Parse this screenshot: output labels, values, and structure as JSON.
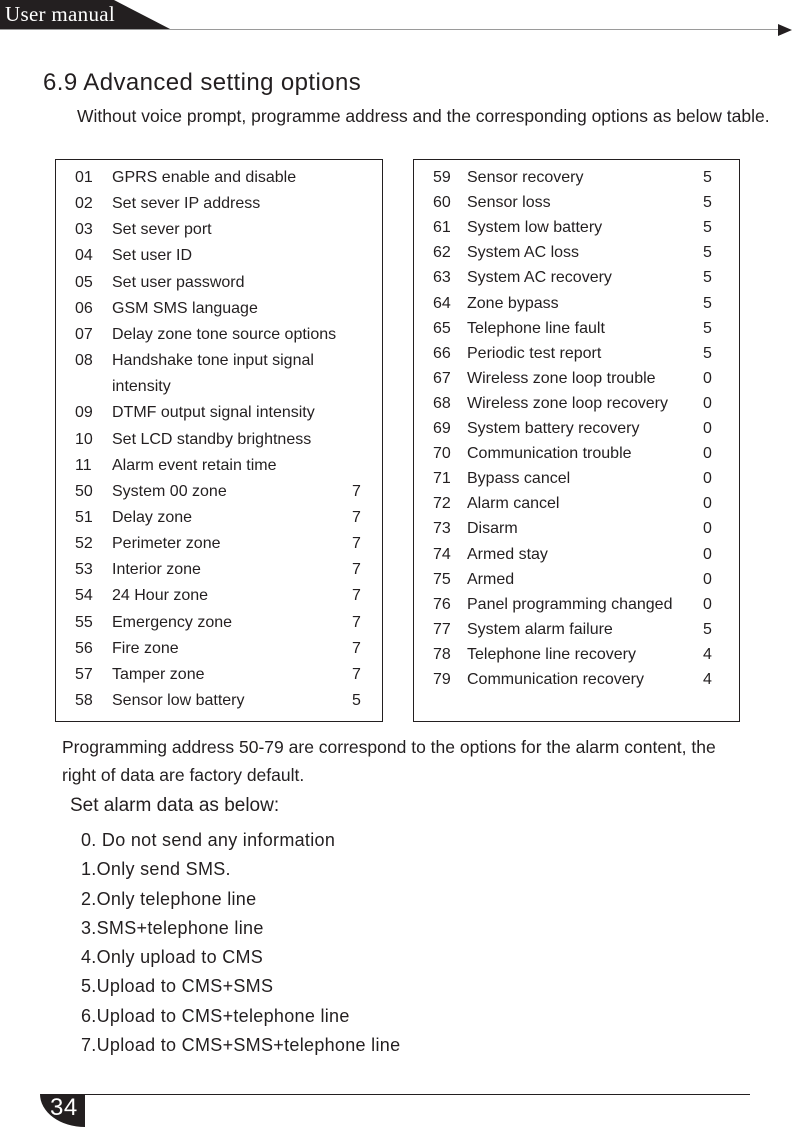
{
  "header": {
    "title": "User manual"
  },
  "section": {
    "title": "6.9 Advanced setting options",
    "intro": "Without voice prompt, programme address and the corresponding options as below table."
  },
  "table_left": [
    {
      "num": "01",
      "label": "GPRS enable and disable",
      "value": ""
    },
    {
      "num": "02",
      "label": "Set sever IP address",
      "value": ""
    },
    {
      "num": "03",
      "label": "Set sever port",
      "value": ""
    },
    {
      "num": "04",
      "label": "Set user ID",
      "value": ""
    },
    {
      "num": "05",
      "label": "Set user password",
      "value": ""
    },
    {
      "num": "06",
      "label": "GSM SMS language",
      "value": ""
    },
    {
      "num": "07",
      "label": "Delay zone tone source options",
      "value": ""
    },
    {
      "num": "08",
      "label": "Handshake tone input signal",
      "value": ""
    },
    {
      "num": "",
      "label": "intensity",
      "value": ""
    },
    {
      "num": "09",
      "label": "DTMF output signal intensity",
      "value": ""
    },
    {
      "num": "10",
      "label": "Set LCD standby brightness",
      "value": ""
    },
    {
      "num": "11",
      "label": "Alarm event retain time",
      "value": ""
    },
    {
      "num": "50",
      "label": "System 00 zone",
      "value": "7"
    },
    {
      "num": "51",
      "label": "Delay zone",
      "value": "7"
    },
    {
      "num": "52",
      "label": "Perimeter zone",
      "value": "7"
    },
    {
      "num": "53",
      "label": "Interior zone",
      "value": "7"
    },
    {
      "num": "54",
      "label": "24 Hour zone",
      "value": "7"
    },
    {
      "num": "55",
      "label": "Emergency zone",
      "value": "7"
    },
    {
      "num": "56",
      "label": "Fire zone",
      "value": "7"
    },
    {
      "num": "57",
      "label": "Tamper zone",
      "value": "7"
    },
    {
      "num": "58",
      "label": "Sensor low battery",
      "value": "5"
    }
  ],
  "table_right": [
    {
      "num": "59",
      "label": "Sensor recovery",
      "value": "5"
    },
    {
      "num": "60",
      "label": "Sensor loss",
      "value": "5"
    },
    {
      "num": "61",
      "label": "System low battery",
      "value": "5"
    },
    {
      "num": "62",
      "label": "System AC loss",
      "value": "5"
    },
    {
      "num": "63",
      "label": "System AC recovery",
      "value": "5"
    },
    {
      "num": "64",
      "label": "Zone bypass",
      "value": "5"
    },
    {
      "num": "65",
      "label": "Telephone line fault",
      "value": "5"
    },
    {
      "num": "66",
      "label": "Periodic test report",
      "value": "5"
    },
    {
      "num": "67",
      "label": "Wireless zone loop trouble",
      "value": "0"
    },
    {
      "num": "68",
      "label": "Wireless zone loop recovery",
      "value": "0"
    },
    {
      "num": "69",
      "label": "System battery recovery",
      "value": "0"
    },
    {
      "num": "70",
      "label": "Communication trouble",
      "value": "0"
    },
    {
      "num": "71",
      "label": "Bypass cancel",
      "value": "0"
    },
    {
      "num": "72",
      "label": "Alarm cancel",
      "value": "0"
    },
    {
      "num": "73",
      "label": "Disarm",
      "value": "0"
    },
    {
      "num": "74",
      "label": "Armed stay",
      "value": "0"
    },
    {
      "num": "75",
      "label": "Armed",
      "value": "0"
    },
    {
      "num": "76",
      "label": "Panel programming changed",
      "value": "0"
    },
    {
      "num": "77",
      "label": "System alarm failure",
      "value": "5"
    },
    {
      "num": "78",
      "label": "Telephone line recovery",
      "value": "4"
    },
    {
      "num": "79",
      "label": "Communication recovery",
      "value": "4"
    }
  ],
  "note": "Programming address 50-79 are correspond to the options for the alarm content, the right of data are factory default.",
  "alarm": {
    "heading": "Set alarm data as below:",
    "options": [
      "0. Do not send any information",
      "1.Only send SMS.",
      "2.Only telephone line",
      "3.SMS+telephone line",
      "4.Only upload to CMS",
      "5.Upload to CMS+SMS",
      "6.Upload to CMS+telephone line",
      "7.Upload to CMS+SMS+telephone line"
    ]
  },
  "footer": {
    "page_number": "34"
  }
}
